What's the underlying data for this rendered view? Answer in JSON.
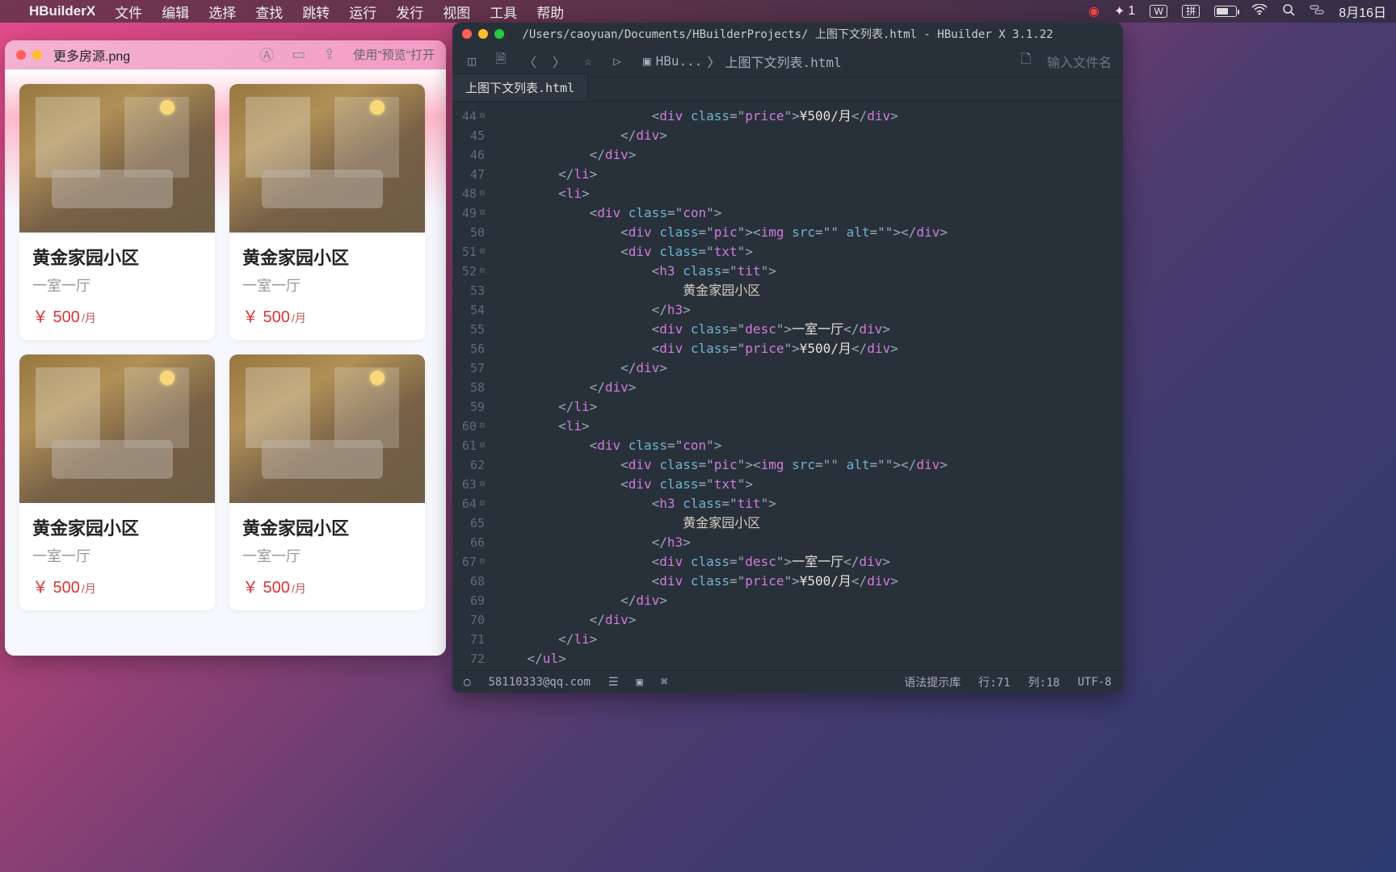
{
  "menubar": {
    "app": "HBuilderX",
    "items": [
      "文件",
      "编辑",
      "选择",
      "查找",
      "跳转",
      "运行",
      "发行",
      "视图",
      "工具",
      "帮助"
    ],
    "wechat_count": "1",
    "input_badge": "拼",
    "w_badge": "W",
    "date": "8月16日"
  },
  "preview": {
    "title": "更多房源.png",
    "open_with": "使用\"预览\"打开",
    "cards": [
      {
        "tit": "黄金家园小区",
        "desc": "一室一厅",
        "price": "￥ 500",
        "unit": "/月"
      },
      {
        "tit": "黄金家园小区",
        "desc": "一室一厅",
        "price": "￥ 500",
        "unit": "/月"
      },
      {
        "tit": "黄金家园小区",
        "desc": "一室一厅",
        "price": "￥ 500",
        "unit": "/月"
      },
      {
        "tit": "黄金家园小区",
        "desc": "一室一厅",
        "price": "￥ 500",
        "unit": "/月"
      }
    ]
  },
  "editor": {
    "title": "/Users/caoyuan/Documents/HBuilderProjects/ 上图下文列表.html - HBuilder X 3.1.22",
    "crumb_folder": "HBu...",
    "crumb_file": "上图下文列表.html",
    "search_placeholder": "输入文件名",
    "tab": "上图下文列表.html",
    "lines_start": 44,
    "lines_end": 72,
    "code": {
      "tit_text": "黄金家园小区",
      "desc_text": "一室一厅",
      "price_text": "¥500/月"
    },
    "status": {
      "email": "58110333@qq.com",
      "hint": "语法提示库",
      "line": "行:71",
      "col": "列:18",
      "enc": "UTF-8"
    }
  }
}
